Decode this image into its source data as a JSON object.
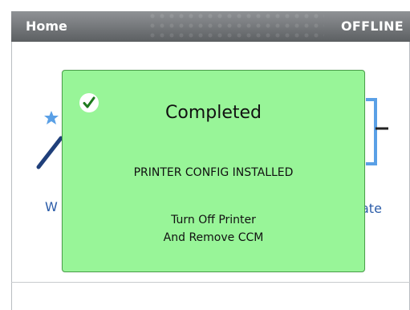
{
  "header": {
    "title": "Home",
    "status": "OFFLINE"
  },
  "tiles": [
    {
      "label": "W",
      "icon": "wand-icon"
    },
    {
      "label": "ate",
      "icon": "cartridge-icon"
    }
  ],
  "dialog": {
    "icon": "check-icon",
    "title": "Completed",
    "message": "PRINTER CONFIG INSTALLED",
    "instruction_line1": "Turn Off Printer",
    "instruction_line2": "And Remove CCM"
  },
  "colors": {
    "header_top": "#8f9295",
    "header_bottom": "#5c5f62",
    "dialog_bg": "#98f598",
    "dialog_border": "#4aa04a",
    "link_blue": "#2b5ca8",
    "icon_blue": "#5aa0e6",
    "icon_navy": "#1f3f7a"
  }
}
